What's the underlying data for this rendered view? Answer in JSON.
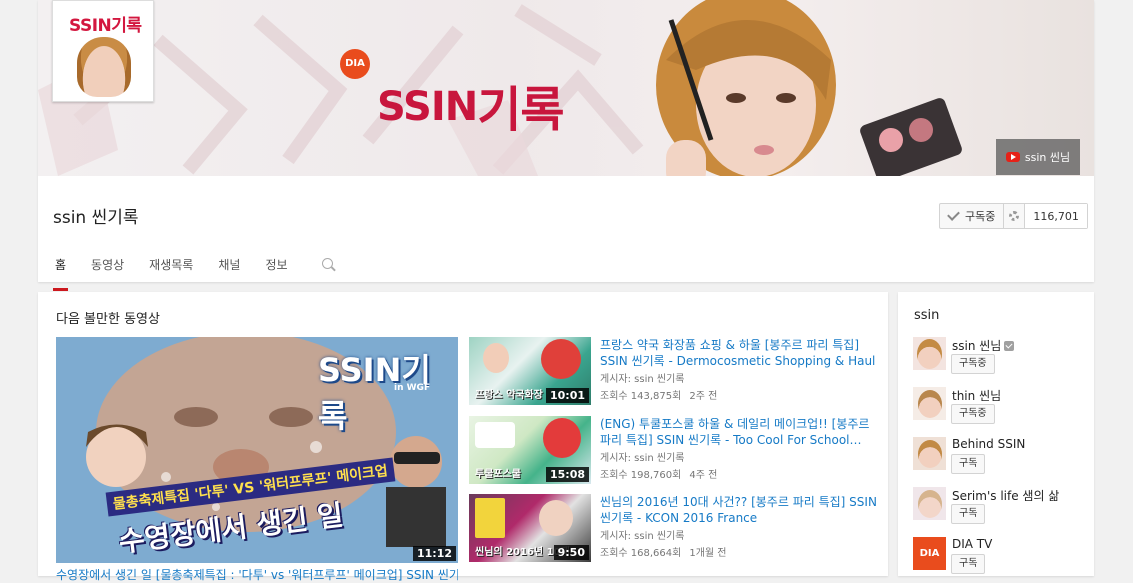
{
  "banner": {
    "avatar_logo_latin": "SSIN",
    "avatar_logo_korean": "기록",
    "dia_badge": "DIA",
    "logo_latin": "SSIN",
    "logo_korean": "기록",
    "link_label": "ssin 씬님"
  },
  "channel": {
    "name": "ssin 씬기록",
    "subscribe_label": "구독중",
    "subscriber_count": "116,701"
  },
  "tabs": [
    {
      "label": "홈",
      "active": true
    },
    {
      "label": "동영상",
      "active": false
    },
    {
      "label": "재생목록",
      "active": false
    },
    {
      "label": "채널",
      "active": false
    },
    {
      "label": "정보",
      "active": false
    }
  ],
  "main": {
    "section_title": "다음 볼만한 동영상",
    "featured": {
      "logo": "SSIN기록",
      "logo_sub": "in WGF",
      "caption1": "물총축제특집 '다투' VS '워터프루프' 메이크업",
      "caption2": "수영장에서 생긴 일",
      "duration": "11:12",
      "title": "수영장에서 생긴 일 [물총축제특집 : '다투' vs '워터프루프' 메이크업] SSIN 씬기"
    },
    "videos": [
      {
        "title": "프랑스 약국 화장품 쇼핑 & 하울 [봉주르 파리 특집] SSIN 씬기록 - Dermocosmetic Shopping & Haul",
        "thumb_label": "프랑스 약국화장",
        "duration": "10:01",
        "channel": "게시자: ssin 씬기록",
        "views": "조회수 143,875회",
        "age": "2주 전"
      },
      {
        "title": "(ENG) 투쿨포스쿨 하울 & 데일리 메이크업!! [봉주르 파리 특집] SSIN 씬기록 - Too Cool For School…",
        "thumb_label": "투쿨포스쿨",
        "duration": "15:08",
        "channel": "게시자: ssin 씬기록",
        "views": "조회수 198,760회",
        "age": "4주 전"
      },
      {
        "title": "씬님의 2016년 10대 사건?? [봉주르 파리 특집] SSIN 씬기록 - KCON 2016 France",
        "thumb_label": "씬님의 2016년 10대",
        "duration": "9:50",
        "channel": "게시자: ssin 씬기록",
        "views": "조회수 168,664회",
        "age": "1개월 전"
      }
    ]
  },
  "sidebar": {
    "title": "ssin",
    "channels": [
      {
        "name": "ssin 씬님",
        "button": "구독중",
        "verified": true
      },
      {
        "name": "thin 씬님",
        "button": "구독중",
        "verified": false
      },
      {
        "name": "Behind SSIN",
        "button": "구독",
        "verified": false
      },
      {
        "name": "Serim's life 샘의 삶",
        "button": "구독",
        "verified": false
      },
      {
        "name": "DIA TV",
        "button": "구독",
        "verified": false,
        "avatar_text": "DIA"
      }
    ]
  },
  "colors": {
    "brand_red": "#c8163d",
    "link_blue": "#167ac6",
    "youtube_red": "#cc181e"
  }
}
